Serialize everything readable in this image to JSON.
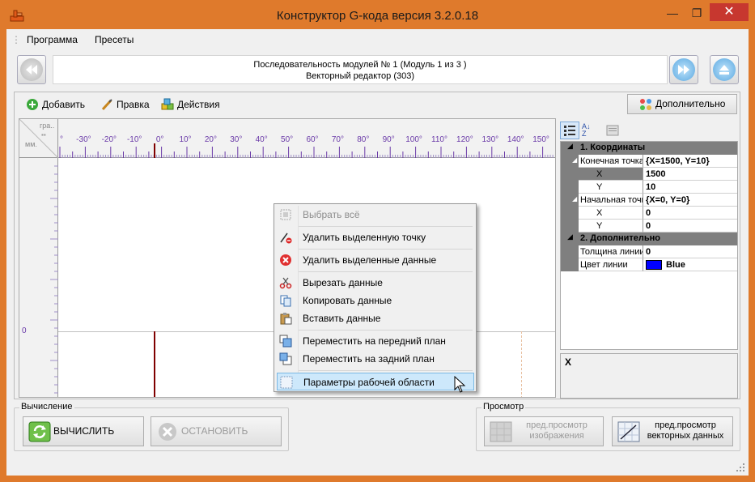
{
  "window": {
    "title": "Конструктор G-кода версия 3.2.0.18"
  },
  "menu": [
    "Программа",
    "Пресеты"
  ],
  "nav": {
    "line1": "Последовательность модулей № 1 (Модуль 1 из 3 )",
    "line2": "Векторный редактор (303)"
  },
  "toolbar": {
    "add": "Добавить",
    "edit": "Правка",
    "actions": "Действия",
    "more": "Дополнительно"
  },
  "ruler": {
    "units_top": "гра..",
    "units_bottom": "мм.",
    "ticks": [
      "°",
      "-30°",
      "-20°",
      "-10°",
      "0°",
      "10°",
      "20°",
      "30°",
      "40°",
      "50°",
      "60°",
      "70°",
      "80°",
      "90°",
      "100°",
      "110°",
      "120°",
      "130°",
      "140°",
      "150°",
      "°"
    ],
    "left_zero": "0"
  },
  "properties": {
    "cat1": "1. Координаты",
    "end_point": {
      "name": "Конечная точка",
      "value": "{X=1500, Y=10}"
    },
    "end_x": {
      "name": "X",
      "value": "1500"
    },
    "end_y": {
      "name": "Y",
      "value": "10"
    },
    "start_point": {
      "name": "Начальная точка",
      "value": "{X=0, Y=0}"
    },
    "start_x": {
      "name": "X",
      "value": "0"
    },
    "start_y": {
      "name": "Y",
      "value": "0"
    },
    "cat2": "2. Дополнительно",
    "thickness": {
      "name": "Толщина линии",
      "value": "0"
    },
    "color": {
      "name": "Цвет линии",
      "value": "Blue",
      "swatch": "#0000ff"
    },
    "desc": "X"
  },
  "context_menu": {
    "select_all": "Выбрать всё",
    "delete_point": "Удалить выделенную точку",
    "delete_data": "Удалить выделенные данные",
    "cut": "Вырезать данные",
    "copy": "Копировать данные",
    "paste": "Вставить данные",
    "bring_front": "Переместить на передний план",
    "send_back": "Переместить на задний план",
    "workspace": "Параметры рабочей области"
  },
  "calc": {
    "group": "Вычисление",
    "run": "ВЫЧИСЛИТЬ",
    "stop": "ОСТАНОВИТЬ"
  },
  "preview": {
    "group": "Просмотр",
    "image_1": "пред.просмотр",
    "image_2": "изображения",
    "vector_1": "пред.просмотр",
    "vector_2": "векторных данных"
  },
  "colors": {
    "frame": "#df7a2c",
    "close": "#c7372f",
    "highlight": "#cde8fb"
  }
}
